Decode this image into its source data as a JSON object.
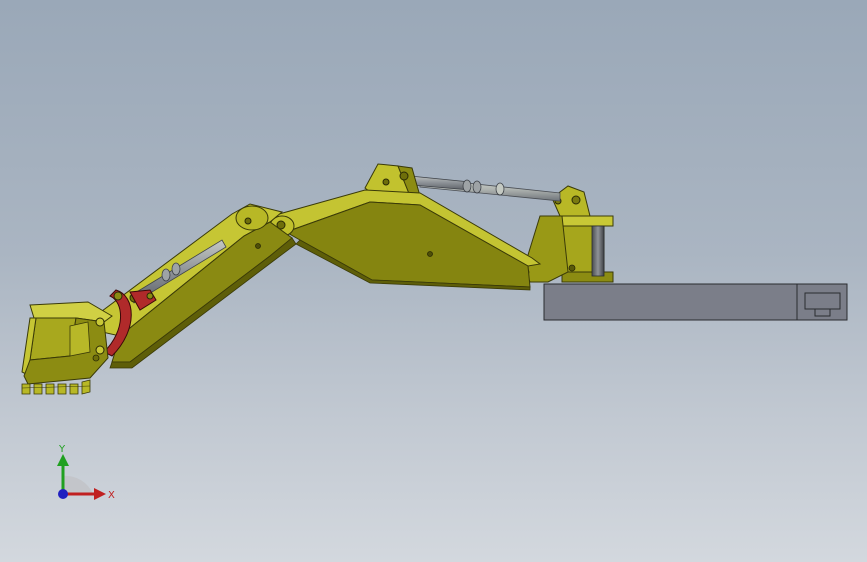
{
  "triad": {
    "y_label": "Y",
    "x_label": "X"
  },
  "colors": {
    "arm_yellow": "#9a9a14",
    "arm_yellow_light": "#c8c830",
    "arm_yellow_dark": "#6e6e0a",
    "cylinder_rod": "#8a8f96",
    "cylinder_rod_light": "#c9cec7",
    "link_red": "#b02a2a",
    "base_gray": "#7b7e89",
    "axis_y": "#20a020",
    "axis_x": "#c02020",
    "axis_z": "#2020c0"
  }
}
